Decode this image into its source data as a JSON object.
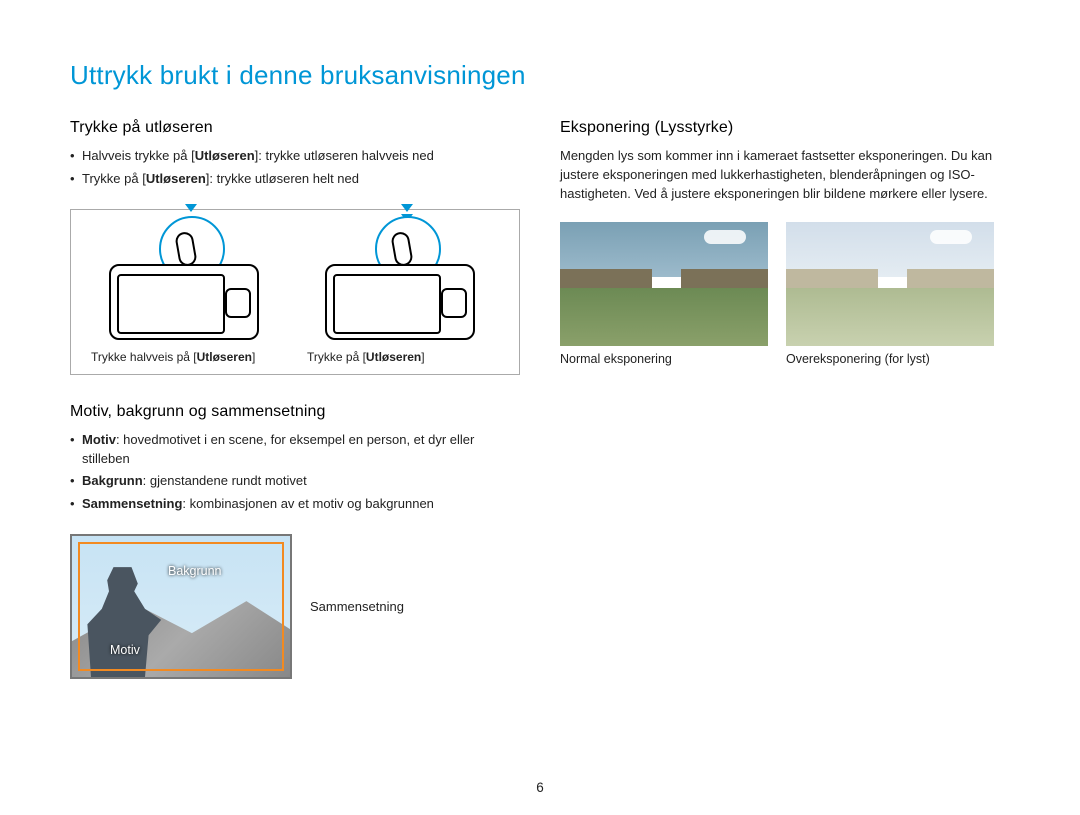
{
  "title": "Uttrykk brukt i denne bruksanvisningen",
  "page_number": "6",
  "left": {
    "shutter": {
      "heading": "Trykke på utløseren",
      "bullets": [
        {
          "pre": "Halvveis trykke på [",
          "bold": "Utløseren",
          "post": "]: trykke utløseren halvveis ned"
        },
        {
          "pre": "Trykke på [",
          "bold": "Utløseren",
          "post": "]: trykke utløseren helt ned"
        }
      ],
      "cap1_pre": "Trykke halvveis på [",
      "cap1_bold": "Utløseren",
      "cap1_post": "]",
      "cap2_pre": "Trykke på [",
      "cap2_bold": "Utløseren",
      "cap2_post": "]"
    },
    "composition": {
      "heading": "Motiv, bakgrunn og sammensetning",
      "bullets": [
        {
          "bold": "Motiv",
          "text": ": hovedmotivet i en scene, for eksempel en person, et dyr eller stilleben"
        },
        {
          "bold": "Bakgrunn",
          "text": ": gjenstandene rundt motivet"
        },
        {
          "bold": "Sammensetning",
          "text": ": kombinasjonen av et motiv og bakgrunnen"
        }
      ],
      "label_bakgrunn": "Bakgrunn",
      "label_motiv": "Motiv",
      "label_sammensetning": "Sammensetning"
    }
  },
  "right": {
    "exposure": {
      "heading": "Eksponering (Lysstyrke)",
      "para": "Mengden lys som kommer inn i kameraet fastsetter eksponeringen. Du kan justere eksponeringen med lukkerhastigheten, blenderåpningen og ISO-hastigheten. Ved å justere eksponeringen blir bildene mørkere eller lysere.",
      "caption_normal": "Normal eksponering",
      "caption_over": "Overeksponering (for lyst)"
    }
  }
}
